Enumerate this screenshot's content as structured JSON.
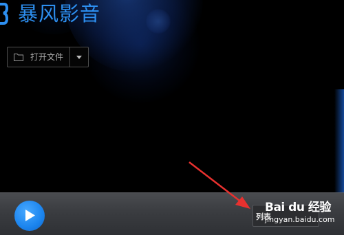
{
  "app": {
    "title": "暴风影音",
    "accent_color": "#2d8ff0"
  },
  "toolbar": {
    "open_file_label": "打开文件",
    "open_file_icon": "folder-icon",
    "dropdown_icon": "caret-down-icon"
  },
  "controls": {
    "play_icon": "play-icon",
    "list_button_label": "列表"
  },
  "watermark": {
    "brand": "Bai du 经验",
    "url": "jingyan.baidu.com"
  },
  "annotation": {
    "arrow_color": "#e8312f"
  }
}
